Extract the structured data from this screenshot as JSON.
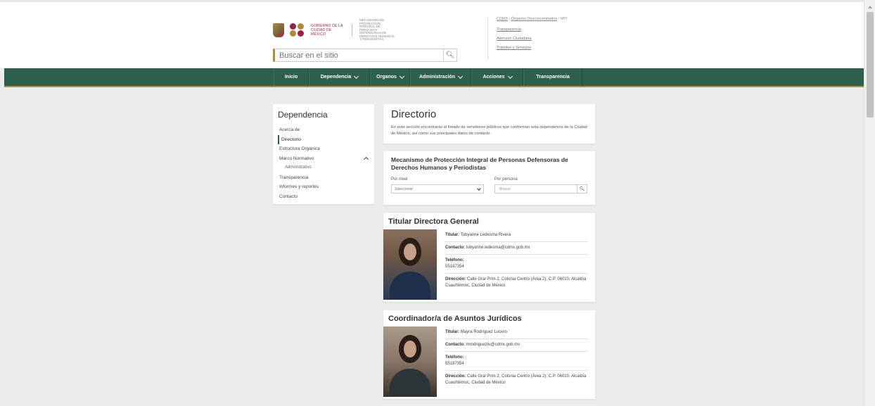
{
  "header": {
    "logo": {
      "gov_text": "GOBIERNO DE LA CIUDAD DE MÉXICO",
      "org_text": "MECANISMO DE PROTECCIÓN INTEGRAL DE PERSONAS DEFENSORAS DE DERECHOS HUMANOS Y PERIODISTAS"
    },
    "search_placeholder": "Buscar en el sitio",
    "breadcrumb": {
      "link1": "CDMX",
      "sep": " / ",
      "link2": "Órganos Desconcentrados",
      "current": "MPI"
    },
    "quick_links": [
      "Transparencia",
      "Atención Ciudadana",
      "Trámites y Servicios"
    ]
  },
  "nav": {
    "items": [
      {
        "label": "Inicio",
        "dropdown": false
      },
      {
        "label": "Dependencia",
        "dropdown": true
      },
      {
        "label": "Organos",
        "dropdown": true
      },
      {
        "label": "Administración",
        "dropdown": true
      },
      {
        "label": "Acciones",
        "dropdown": true
      },
      {
        "label": "Transparencia",
        "dropdown": false
      }
    ]
  },
  "sidebar": {
    "title": "Dependencia",
    "items": [
      {
        "label": "Acerca de"
      },
      {
        "label": "Directorio"
      },
      {
        "label": "Estructura Orgánica"
      },
      {
        "label": "Marco Normativo"
      },
      {
        "label": "Administrativo"
      },
      {
        "label": "Transparencia"
      },
      {
        "label": "Informes y reportes"
      },
      {
        "label": "Contacto"
      }
    ]
  },
  "directorio": {
    "title": "Directorio",
    "description": "En esta sección encontrarás el listado de servidores públicos que conforman esta dependencia de la Ciudad de México, así como sus principales datos de contacto."
  },
  "filter": {
    "title": "Mecanismo de Protección Integral de Personas Defensoras de Derechos Humanos y Periodistas",
    "by_level_label": "Por nivel",
    "by_level_value": "Seleccionar",
    "by_person_label": "Por persona",
    "by_person_placeholder": "Buscar"
  },
  "people": [
    {
      "position": "Titular Directora General",
      "titular_label": "Titular:",
      "titular": "Tobyanne Ledesma Rivera",
      "contacto_label": "Contacto:",
      "contacto": "tobyanne.ledesma@cdmx.gob.mx",
      "telefono_label": "Teléfono:",
      "telefono": "55187354",
      "direccion_label": "Dirección:",
      "direccion": "Calle Gral Prim 2, Colonia Centro (Área 2), C.P. 06010, Alcaldía Cuauhtémoc, Ciudad de México"
    },
    {
      "position": "Coordinador/a de Asuntos Jurídicos",
      "titular_label": "Titular:",
      "titular": "Mayra Rodríguez Lucero",
      "contacto_label": "Contacto:",
      "contacto": "mrodriguezlu@cdmx.gob.mx",
      "telefono_label": "Teléfono:",
      "telefono": "55187354",
      "direccion_label": "Dirección:",
      "direccion": "Calle Gral Prim 2, Colonia Centro (Área 2), C.P. 06010, Alcaldía Cuauhtémoc, Ciudad de México"
    }
  ],
  "colors": {
    "nav_green": "#2d5f4f",
    "gold_accent": "#b08a3e",
    "page_bg": "#ececec"
  }
}
